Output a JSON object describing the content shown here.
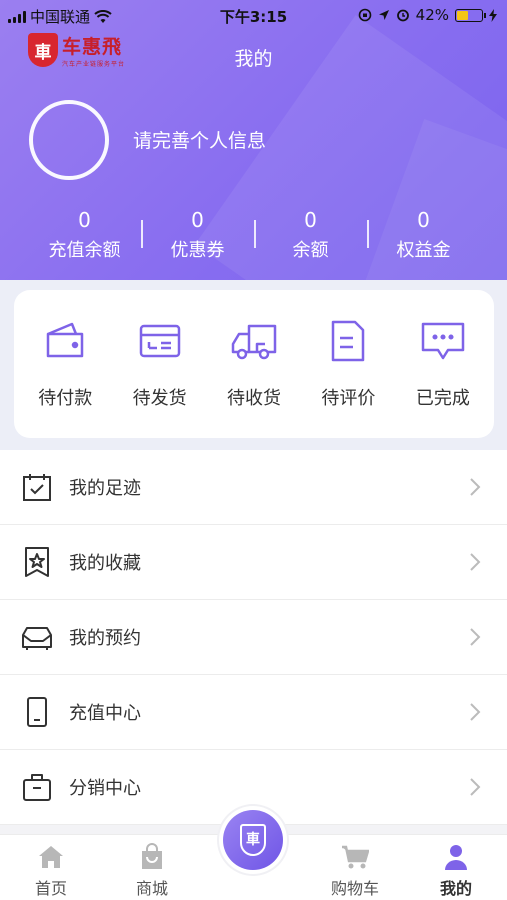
{
  "status_bar": {
    "carrier": "中国联通",
    "time": "下午3:15",
    "battery": "42%",
    "battery_level": 0.42
  },
  "header": {
    "brand_name": "车惠飛",
    "brand_subtitle": "汽车产业链服务平台",
    "title": "我的",
    "profile_prompt": "请完善个人信息"
  },
  "stats": [
    {
      "value": "0",
      "label": "充值余额"
    },
    {
      "value": "0",
      "label": "优惠券"
    },
    {
      "value": "0",
      "label": "余额"
    },
    {
      "value": "0",
      "label": "权益金"
    }
  ],
  "orders": [
    {
      "label": "待付款",
      "icon": "wallet-icon"
    },
    {
      "label": "待发货",
      "icon": "card-icon"
    },
    {
      "label": "待收货",
      "icon": "truck-icon"
    },
    {
      "label": "待评价",
      "icon": "document-icon"
    },
    {
      "label": "已完成",
      "icon": "message-icon"
    }
  ],
  "menu": [
    {
      "label": "我的足迹",
      "icon": "calendar-check-icon"
    },
    {
      "label": "我的收藏",
      "icon": "star-bookmark-icon"
    },
    {
      "label": "我的预约",
      "icon": "car-icon"
    },
    {
      "label": "充值中心",
      "icon": "phone-icon"
    },
    {
      "label": "分销中心",
      "icon": "briefcase-icon"
    }
  ],
  "tabbar": [
    {
      "label": "首页",
      "icon": "home-icon"
    },
    {
      "label": "商城",
      "icon": "shopping-bag-icon"
    },
    {
      "label": "购物车",
      "icon": "cart-icon"
    },
    {
      "label": "我的",
      "icon": "user-icon"
    }
  ],
  "colors": {
    "primary": "#8a6ff0",
    "icon_purple": "#7e63e8",
    "text": "#333333"
  }
}
